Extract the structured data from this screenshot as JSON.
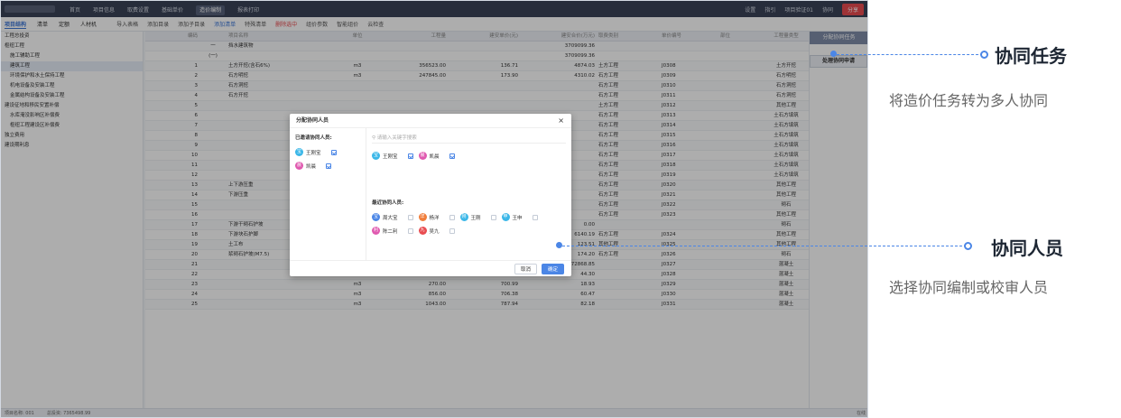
{
  "app": {
    "topmenu": [
      "首页",
      "项目信息",
      "取费设置",
      "基础单价",
      "造价编制",
      "报表打印"
    ],
    "topmenu_active_index": 4,
    "topright": [
      "设置",
      "指引",
      "项目验证01",
      "协同"
    ],
    "share_label": "分享",
    "view_tabs": [
      "项目结构",
      "清单",
      "定额",
      "人材机"
    ],
    "tools": [
      "导入表格",
      "添加目录",
      "添加子目录",
      "添加清单",
      "特殊清单",
      "删除选中",
      "组价参数",
      "智能组价",
      "云检查"
    ]
  },
  "sidebar": [
    "工程总投资",
    "枢纽工程",
    "施工辅助工程",
    "建筑工程",
    "环境保护和水土保持工程",
    "机电设备及安装工程",
    "金属结构设备及安装工程",
    "建设征地和移民安置补偿",
    "水库淹没影响区补偿费",
    "枢纽工程建设区补偿费",
    "独立费用",
    "建设期利息"
  ],
  "grid": {
    "headers": [
      "编码",
      "",
      "项目名称",
      "单位",
      "工程量",
      "建安单价(元)",
      "建安合价(万元)",
      "取费类别",
      "单价编号",
      "部位",
      "工程量类型"
    ],
    "rows": [
      [
        "",
        "一",
        "挡水建筑物",
        "",
        "",
        "",
        "3709099.36",
        "",
        "",
        "",
        ""
      ],
      [
        "",
        "(一)",
        "",
        "",
        "",
        "",
        "3709099.36",
        "",
        "",
        "",
        ""
      ],
      [
        "1",
        "",
        "土方开挖(含石6%)",
        "m3",
        "356523.00",
        "136.71",
        "4874.03",
        "土方工程",
        "J0308",
        "",
        "土方开挖"
      ],
      [
        "2",
        "",
        "石方明挖",
        "m3",
        "247845.00",
        "173.90",
        "4310.02",
        "石方工程",
        "J0309",
        "",
        "石方明挖"
      ],
      [
        "3",
        "",
        "石方洞挖",
        "",
        "",
        "",
        "",
        "石方工程",
        "J0310",
        "",
        "石方洞挖"
      ],
      [
        "4",
        "",
        "石方开挖",
        "",
        "",
        "",
        "",
        "石方工程",
        "J0311",
        "",
        "石方洞挖"
      ],
      [
        "5",
        "",
        "",
        "",
        "",
        "",
        "",
        "土方工程",
        "J0312",
        "",
        "其他工程"
      ],
      [
        "6",
        "",
        "",
        "",
        "",
        "",
        "",
        "石方工程",
        "J0313",
        "",
        "土石方填筑"
      ],
      [
        "7",
        "",
        "",
        "",
        "",
        "",
        "",
        "石方工程",
        "J0314",
        "",
        "土石方填筑"
      ],
      [
        "8",
        "",
        "",
        "",
        "",
        "",
        "",
        "石方工程",
        "J0315",
        "",
        "土石方填筑"
      ],
      [
        "9",
        "",
        "",
        "",
        "",
        "",
        "",
        "石方工程",
        "J0316",
        "",
        "土石方填筑"
      ],
      [
        "10",
        "",
        "",
        "",
        "",
        "",
        "",
        "石方工程",
        "J0317",
        "",
        "土石方填筑"
      ],
      [
        "11",
        "",
        "",
        "",
        "",
        "",
        "",
        "石方工程",
        "J0318",
        "",
        "土石方填筑"
      ],
      [
        "12",
        "",
        "",
        "",
        "",
        "",
        "",
        "石方工程",
        "J0319",
        "",
        "土石方填筑"
      ],
      [
        "13",
        "",
        "上下游压重",
        "",
        "",
        "",
        "",
        "石方工程",
        "J0320",
        "",
        "其他工程"
      ],
      [
        "14",
        "",
        "下游压重",
        "",
        "",
        "",
        "",
        "石方工程",
        "J0321",
        "",
        "其他工程"
      ],
      [
        "15",
        "",
        "",
        "",
        "",
        "",
        "",
        "石方工程",
        "J0322",
        "",
        "砌石"
      ],
      [
        "16",
        "",
        "",
        "",
        "",
        "",
        "",
        "石方工程",
        "J0323",
        "",
        "其他工程"
      ],
      [
        "17",
        "",
        "下游干砌石护坡",
        "m3",
        "0.00",
        "",
        "0.00",
        "",
        "",
        "",
        "砌石"
      ],
      [
        "18",
        "",
        "下游块石护脚",
        "m3",
        "2685.00",
        "22,868.50",
        "6140.19",
        "石方工程",
        "J0324",
        "",
        "其他工程"
      ],
      [
        "19",
        "",
        "土工布",
        "m2",
        "415.00",
        "2,976.10",
        "123.51",
        "其他工程",
        "J0325",
        "",
        "其他工程"
      ],
      [
        "20",
        "",
        "浆砌石护坡(M7.5)",
        "m3",
        "3570.00",
        "487.96",
        "174.20",
        "石方工程",
        "J0326",
        "",
        "砌石"
      ],
      [
        "21",
        "",
        "",
        "m3",
        "11523.00",
        "236,801.92",
        "272868.85",
        "",
        "J0327",
        "",
        "混凝土"
      ],
      [
        "22",
        "",
        "",
        "m3",
        "676.00",
        "655.32",
        "44.30",
        "",
        "J0328",
        "",
        "混凝土"
      ],
      [
        "23",
        "",
        "",
        "m3",
        "270.00",
        "700.99",
        "18.93",
        "",
        "J0329",
        "",
        "混凝土"
      ],
      [
        "24",
        "",
        "",
        "m3",
        "856.00",
        "706.38",
        "60.47",
        "",
        "J0330",
        "",
        "混凝土"
      ],
      [
        "25",
        "",
        "",
        "m3",
        "1043.00",
        "787.94",
        "82.18",
        "",
        "J0331",
        "",
        "混凝土"
      ]
    ]
  },
  "rightpanel": {
    "head": "分配协同任务",
    "menu": "处理协同申请"
  },
  "footer": {
    "left": [
      "项目名称: 001",
      "总投资: 7365498.99"
    ],
    "right": "在线"
  },
  "modal": {
    "title": "分配协同人员",
    "invited_label": "已邀请协同人员:",
    "search_placeholder": "请输入关键字搜索",
    "recent_label": "最近协同人员:",
    "invited": [
      {
        "name": "王刚宝",
        "color": "#3bb7e8",
        "checked": true
      },
      {
        "name": "凯晨",
        "color": "#e05ab0",
        "checked": true
      }
    ],
    "search_results": [
      {
        "name": "王刚宝",
        "color": "#3bb7e8",
        "checked": true
      },
      {
        "name": "凯晨",
        "color": "#e05ab0",
        "checked": true
      }
    ],
    "recent": [
      {
        "name": "周大宝",
        "color": "#4b86e6",
        "checked": false
      },
      {
        "name": "杨洋",
        "color": "#f07d3a",
        "checked": false
      },
      {
        "name": "王刚",
        "color": "#3bb7e8",
        "checked": false
      },
      {
        "name": "王申",
        "color": "#3bb7e8",
        "checked": false
      },
      {
        "name": "陈二利",
        "color": "#e05ab0",
        "checked": false
      },
      {
        "name": "吴九",
        "color": "#e94c50",
        "checked": false
      }
    ],
    "cancel": "取消",
    "ok": "确定"
  },
  "callouts": {
    "task_title": "协同任务",
    "task_desc": "将造价任务转为多人协同",
    "people_title": "协同人员",
    "people_desc": "选择协同编制或校审人员"
  }
}
